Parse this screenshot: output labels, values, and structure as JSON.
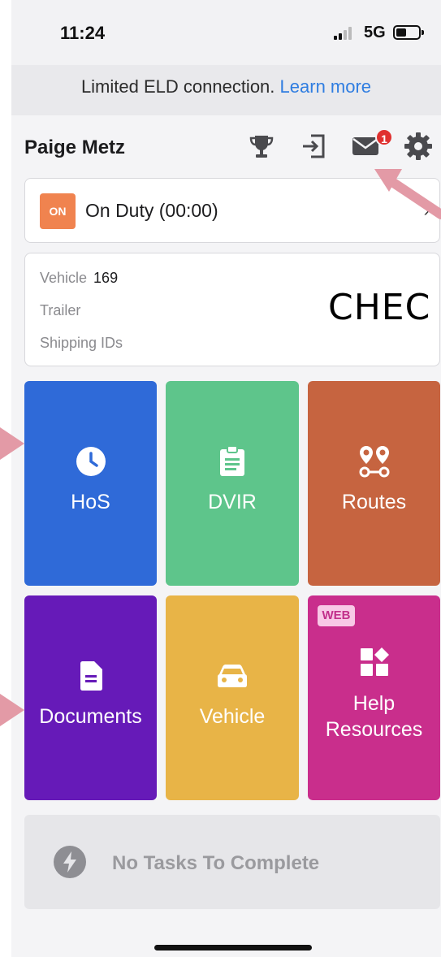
{
  "status_bar": {
    "time": "11:24",
    "network": "5G"
  },
  "banner": {
    "text": "Limited ELD connection.",
    "link": "Learn more"
  },
  "header": {
    "driver_name": "Paige Metz",
    "messages_badge": "1"
  },
  "icons": {
    "trophy": "trophy-icon",
    "logout": "logout-icon",
    "mail": "mail-icon",
    "settings": "gear-icon"
  },
  "duty": {
    "status_code": "ON",
    "label": "On Duty (00:00)"
  },
  "vehicle_info": {
    "vehicle_label": "Vehicle",
    "vehicle_value": "169",
    "trailer_label": "Trailer",
    "shipping_label": "Shipping IDs"
  },
  "overlay_text": "CHEC",
  "tiles": [
    {
      "label": "HoS",
      "color": "#2f6ad8",
      "icon": "clock-icon"
    },
    {
      "label": "DVIR",
      "color": "#5ec58b",
      "icon": "clipboard-icon"
    },
    {
      "label": "Routes",
      "color": "#c66440",
      "icon": "route-pins-icon"
    },
    {
      "label": "Documents",
      "color": "#661ab8",
      "icon": "document-icon"
    },
    {
      "label": "Vehicle",
      "color": "#e8b447",
      "icon": "car-icon"
    },
    {
      "label_line1": "Help",
      "label_line2": "Resources",
      "color": "#c92e8c",
      "icon": "shapes-icon",
      "tag": "WEB"
    }
  ],
  "tasks": {
    "text": "No Tasks To Complete"
  }
}
